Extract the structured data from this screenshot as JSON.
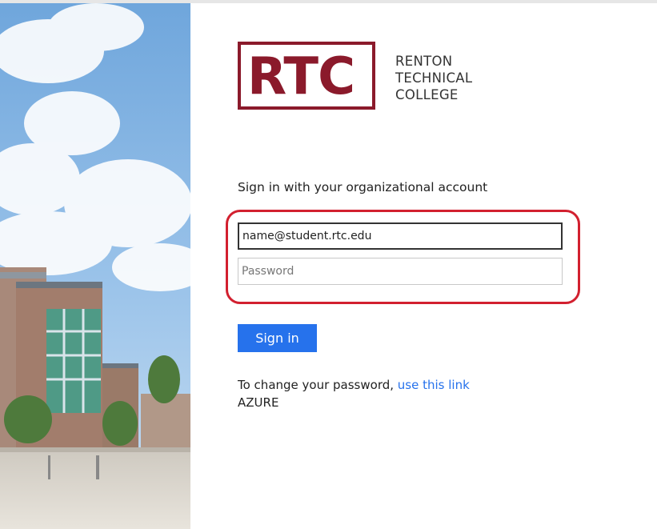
{
  "logo": {
    "mark": "RTC",
    "lines": [
      "RENTON",
      "TECHNICAL",
      "COLLEGE"
    ],
    "brand_color": "#8b1a2b"
  },
  "heading": "Sign in with your organizational account",
  "email": {
    "value": "name@student.rtc.edu"
  },
  "password": {
    "placeholder": "Password"
  },
  "highlight_color": "#d2202f",
  "sign_in": {
    "label": "Sign in",
    "color": "#2672ec"
  },
  "help": {
    "prefix": "To change your password, ",
    "link_text": "use this link"
  },
  "footer_label": "AZURE"
}
